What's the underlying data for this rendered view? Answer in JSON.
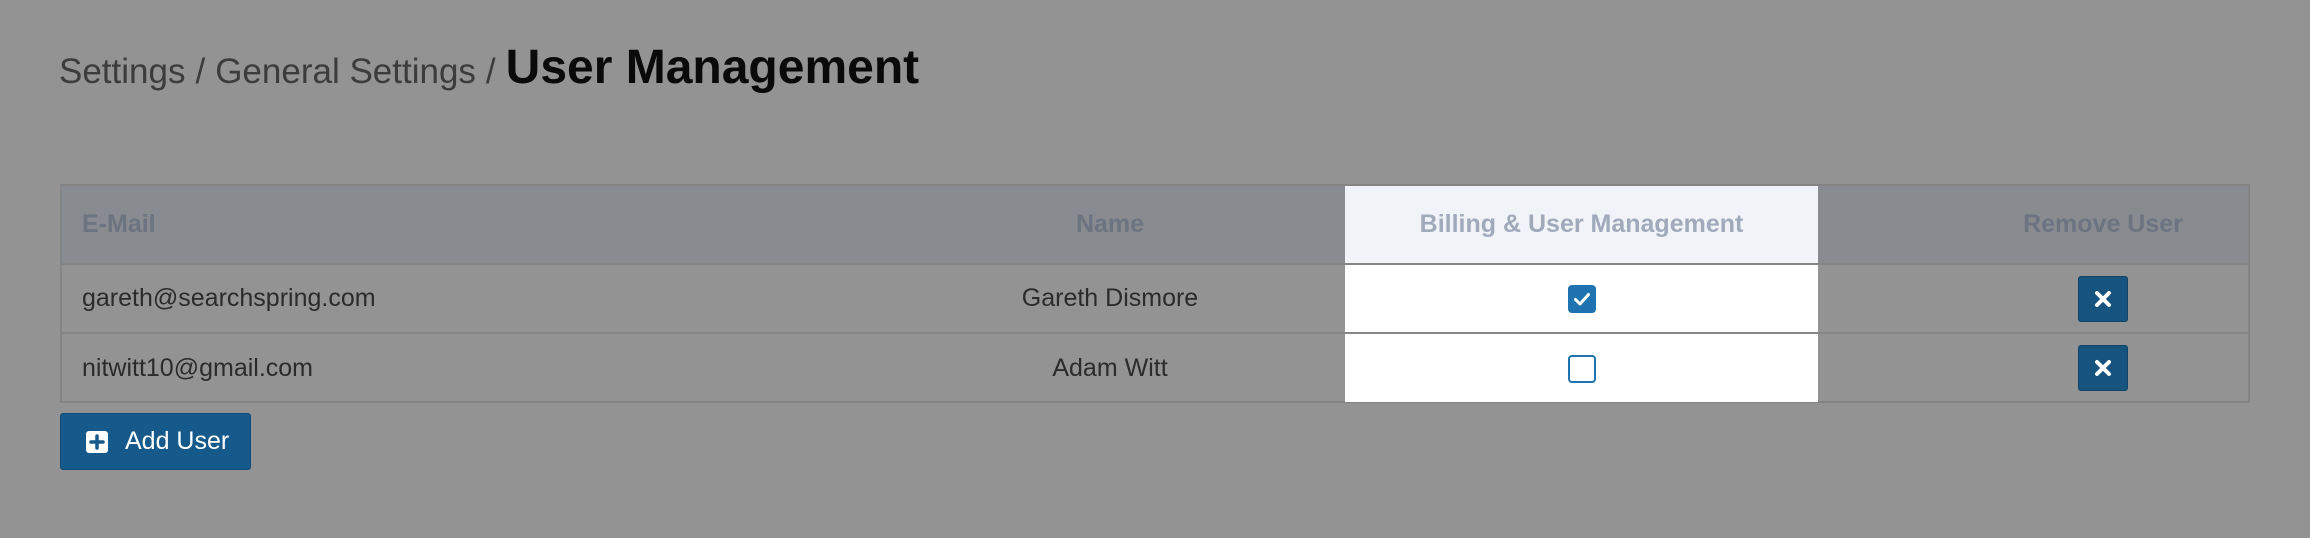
{
  "breadcrumb": {
    "level1": "Settings",
    "level2": "General Settings",
    "separator": "/",
    "current": "User Management"
  },
  "table": {
    "headers": {
      "email": "E-Mail",
      "name": "Name",
      "billing": "Billing & User Management",
      "remove": "Remove User"
    },
    "rows": [
      {
        "email": "gareth@searchspring.com",
        "name": "Gareth Dismore",
        "billing_checked": true
      },
      {
        "email": "nitwitt10@gmail.com",
        "name": "Adam Witt",
        "billing_checked": false
      }
    ]
  },
  "actions": {
    "add_user_label": "Add User"
  },
  "icons": {
    "checkbox_checked": "check-icon",
    "remove": "times-icon",
    "add": "plus-square-icon"
  },
  "colors": {
    "overlay_background": "#939393",
    "accent_blue": "#1e73b0",
    "button_dark_blue": "#16537e",
    "highlight_column": "#ffffff"
  }
}
